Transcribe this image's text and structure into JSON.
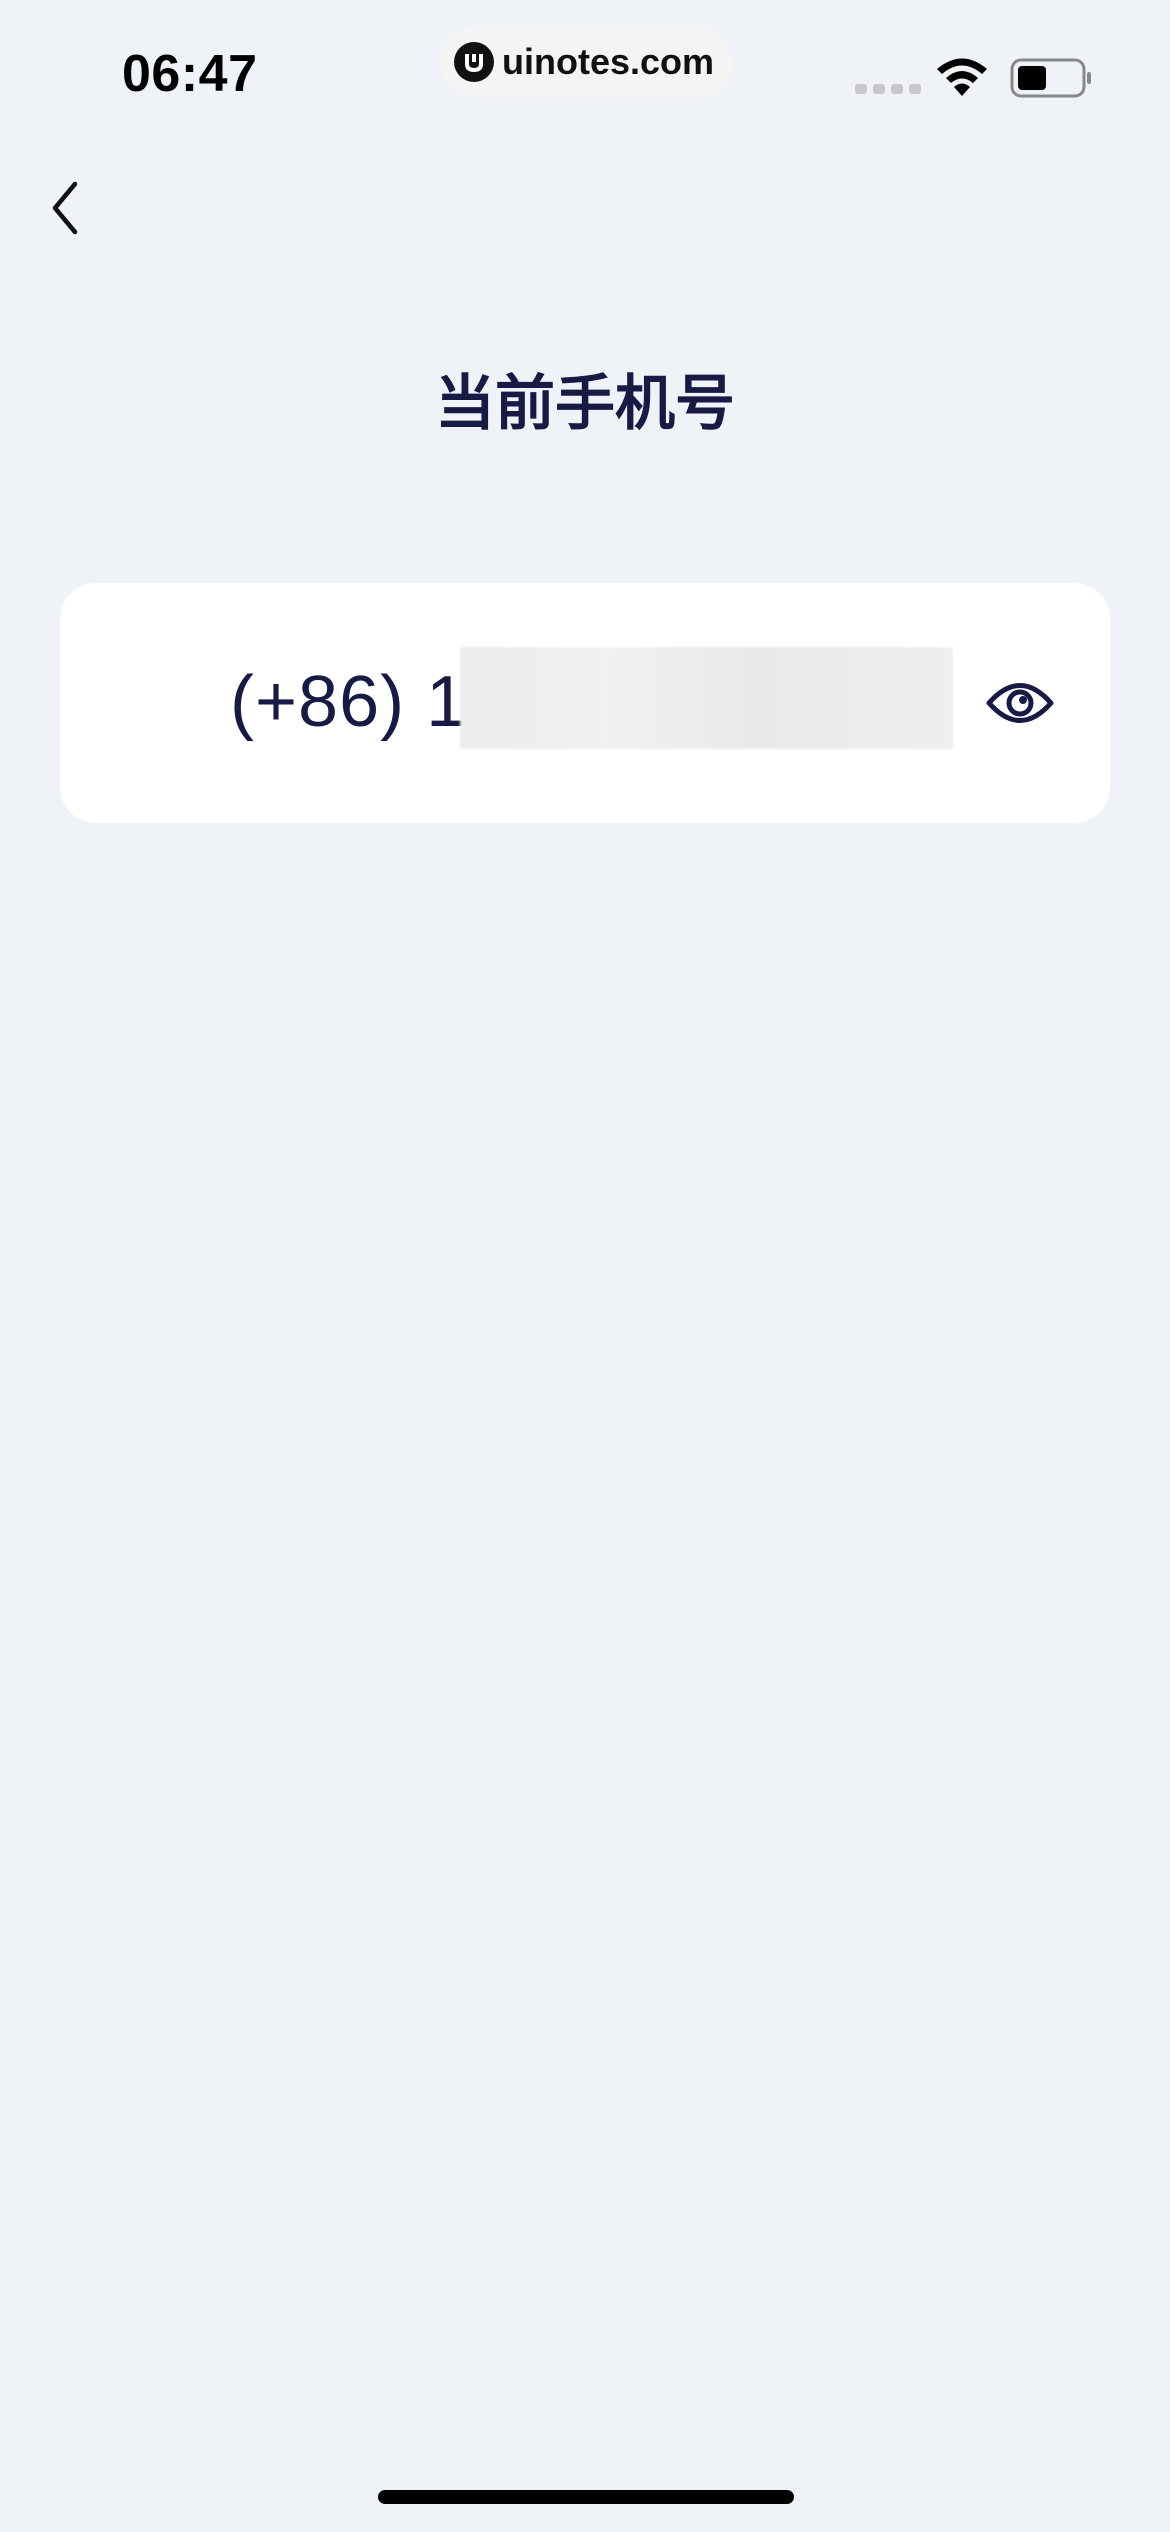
{
  "status_bar": {
    "time": "06:47",
    "watermark": "uinotes.com",
    "icons": [
      "signal-icon",
      "wifi-icon",
      "battery-icon"
    ]
  },
  "nav": {
    "back_icon": "chevron-left-icon"
  },
  "page": {
    "title": "当前手机号"
  },
  "phone_card": {
    "phone_prefix": "(+86) 1",
    "toggle_icon": "eye-icon"
  },
  "colors": {
    "background": "#eff2f6",
    "card": "#ffffff",
    "text_primary": "#171a44"
  }
}
